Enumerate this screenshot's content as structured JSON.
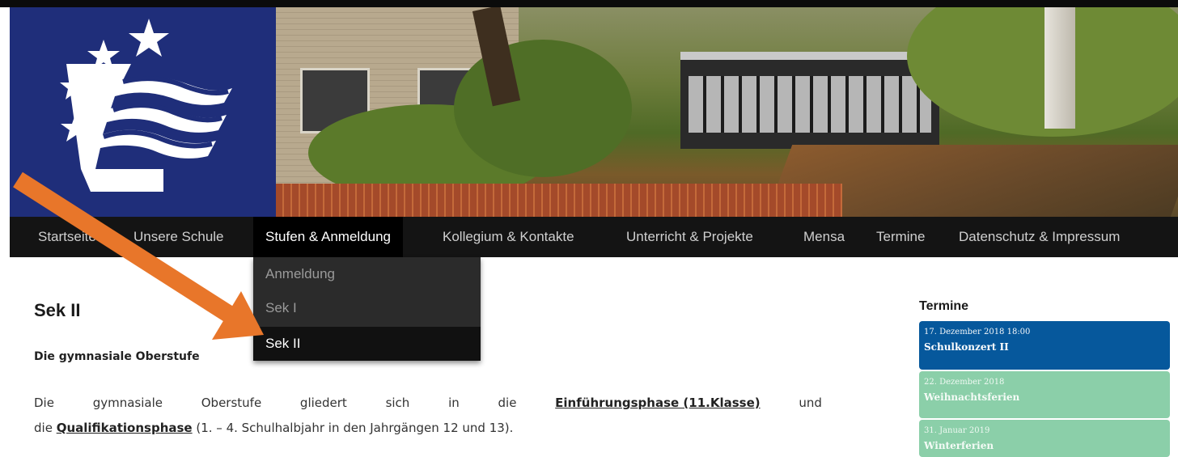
{
  "nav": {
    "items": [
      {
        "label": "Startseite",
        "active": false
      },
      {
        "label": "Unsere Schule",
        "active": false
      },
      {
        "label": "Stufen & Anmeldung",
        "active": true
      },
      {
        "label": "Kollegium & Kontakte",
        "active": false
      },
      {
        "label": "Unterricht & Projekte",
        "active": false
      },
      {
        "label": "Mensa",
        "active": false
      },
      {
        "label": "Termine",
        "active": false
      },
      {
        "label": "Datenschutz & Impressum",
        "active": false
      }
    ],
    "dropdown": [
      {
        "label": "Anmeldung",
        "current": false
      },
      {
        "label": "Sek I",
        "current": false
      },
      {
        "label": "Sek II",
        "current": true
      }
    ]
  },
  "main": {
    "title": "Sek II",
    "intro": "Die gymnasiale Oberstufe",
    "paragraph": {
      "w1": "Die",
      "w2": "gymnasiale",
      "w3": "Oberstufe",
      "w4": "gliedert",
      "w5": "sich",
      "w6": "in",
      "w7": "die",
      "link1": "Einführungsphase (11.Klasse)",
      "w8": "und",
      "l2_start": "die ",
      "link2": "Qualifikationsphase",
      "l2_end": " (1. – 4. Schulhalbjahr in den Jahrgängen 12 und 13)."
    }
  },
  "sidebar": {
    "title": "Termine",
    "events": [
      {
        "date": "17. Dezember 2018 18:00",
        "title": "Schulkonzert II"
      },
      {
        "date": "22. Dezember 2018",
        "title": "Weihnachtsferien"
      },
      {
        "date": "31. Januar 2019",
        "title": "Winterferien"
      }
    ]
  },
  "colors": {
    "logo_blue": "#1f2e7a",
    "nav_bg": "#141414",
    "event_primary": "#06589c",
    "event_secondary": "#8bcfa9",
    "arrow": "#e8762a"
  }
}
